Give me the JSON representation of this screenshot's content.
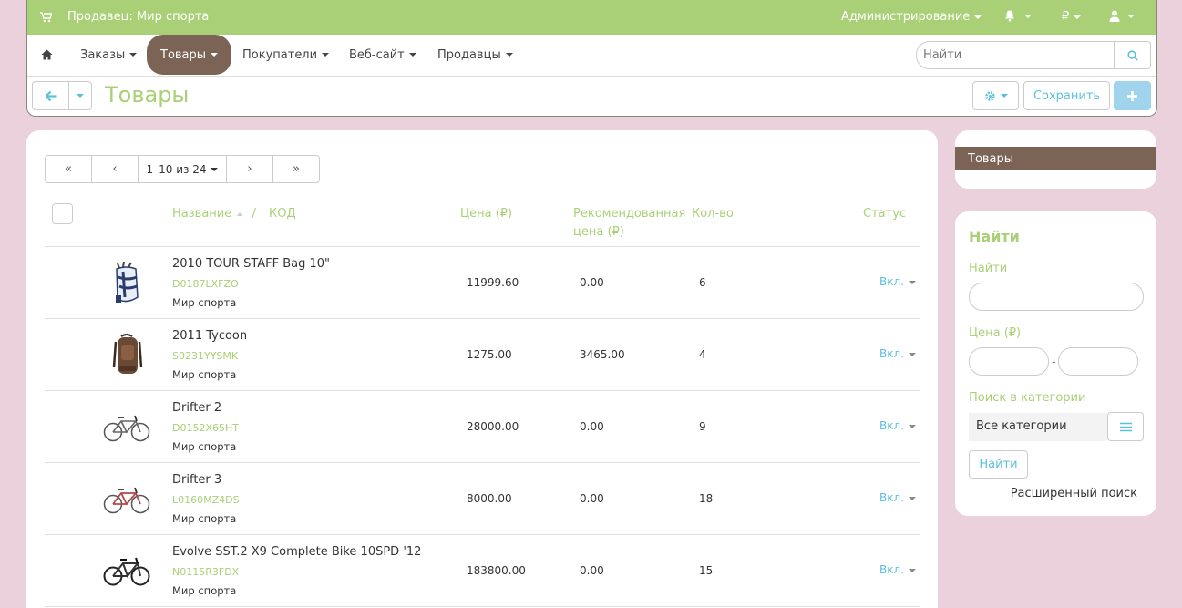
{
  "topbar": {
    "vendor_label": "Продавец: Мир спорта",
    "admin_label": "Администрирование",
    "currency_label": "₽"
  },
  "nav": {
    "items": [
      {
        "label": "Заказы"
      },
      {
        "label": "Товары",
        "active": true
      },
      {
        "label": "Покупатели"
      },
      {
        "label": "Веб-сайт"
      },
      {
        "label": "Продавцы"
      }
    ],
    "search_placeholder": "Найти"
  },
  "toolbar": {
    "page_title": "Товары",
    "save_label": "Сохранить"
  },
  "pager": {
    "first": "«",
    "prev": "‹",
    "range": "1–10 из 24",
    "next": "›",
    "last": "»"
  },
  "table": {
    "headers": {
      "name": "Название",
      "separator": "/",
      "code": "КОД",
      "price": "Цена (₽)",
      "recommended_line1": "Рекомендованная",
      "recommended_line2": "цена (₽)",
      "qty": "Кол-во",
      "status": "Статус"
    },
    "rows": [
      {
        "name": "2010 TOUR STAFF Bag 10\"",
        "code": "D0187LXFZO",
        "seller": "Мир спорта",
        "price": "11999.60",
        "recommended": "0.00",
        "qty": "6",
        "status": "Вкл.",
        "image": "golf-bag"
      },
      {
        "name": "2011 Tycoon",
        "code": "S0231YYSMK",
        "seller": "Мир спорта",
        "price": "1275.00",
        "recommended": "3465.00",
        "qty": "4",
        "status": "Вкл.",
        "image": "backpack"
      },
      {
        "name": "Drifter 2",
        "code": "D0152X65HT",
        "seller": "Мир спорта",
        "price": "28000.00",
        "recommended": "0.00",
        "qty": "9",
        "status": "Вкл.",
        "image": "bicycle"
      },
      {
        "name": "Drifter 3",
        "code": "L0160MZ4DS",
        "seller": "Мир спорта",
        "price": "8000.00",
        "recommended": "0.00",
        "qty": "18",
        "status": "Вкл.",
        "image": "bicycle"
      },
      {
        "name": "Evolve SST.2 X9 Complete Bike 10SPD '12",
        "code": "N0115R3FDX",
        "seller": "Мир спорта",
        "price": "183800.00",
        "recommended": "0.00",
        "qty": "15",
        "status": "Вкл.",
        "image": "bicycle"
      }
    ]
  },
  "sidebar": {
    "active_item": "Товары",
    "search": {
      "heading": "Найти",
      "find_label": "Найти",
      "price_label": "Цена (₽)",
      "price_separator": "-",
      "category_label": "Поиск в категории",
      "category_value": "Все категории",
      "find_button": "Найти",
      "advanced_link": "Расширенный поиск"
    }
  },
  "colors": {
    "accent_green": "#a9d076",
    "brown": "#7b6356",
    "info_blue": "#5bc0de",
    "background": "#ead1dc"
  }
}
